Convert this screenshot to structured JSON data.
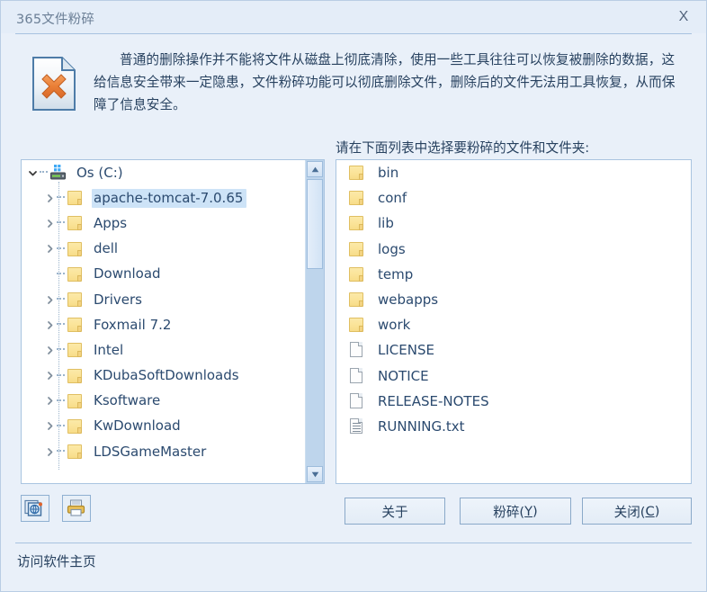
{
  "window": {
    "title": "365文件粉碎",
    "close_label": "X"
  },
  "header": {
    "icon": "shredded-file-icon",
    "description": "普通的删除操作并不能将文件从磁盘上彻底清除，使用一些工具往往可以恢复被删除的数据，这给信息安全带来一定隐患，文件粉碎功能可以彻底删除文件，删除后的文件无法用工具恢复，从而保障了信息安全。"
  },
  "list_label": "请在下面列表中选择要粉碎的文件和文件夹:",
  "tree": {
    "items": [
      {
        "label": "Os (C:)",
        "icon": "drive-icon",
        "expander": "chevron-down",
        "depth": 0,
        "selected": false
      },
      {
        "label": "apache-tomcat-7.0.65",
        "icon": "folder-icon",
        "expander": "chevron-right",
        "depth": 1,
        "selected": true
      },
      {
        "label": "Apps",
        "icon": "folder-icon",
        "expander": "chevron-right",
        "depth": 1,
        "selected": false
      },
      {
        "label": "dell",
        "icon": "folder-icon",
        "expander": "chevron-right",
        "depth": 1,
        "selected": false
      },
      {
        "label": "Download",
        "icon": "folder-icon",
        "expander": "none",
        "depth": 1,
        "selected": false
      },
      {
        "label": "Drivers",
        "icon": "folder-icon",
        "expander": "chevron-right",
        "depth": 1,
        "selected": false
      },
      {
        "label": "Foxmail 7.2",
        "icon": "folder-icon",
        "expander": "chevron-right",
        "depth": 1,
        "selected": false
      },
      {
        "label": "Intel",
        "icon": "folder-icon",
        "expander": "chevron-right",
        "depth": 1,
        "selected": false
      },
      {
        "label": "KDubaSoftDownloads",
        "icon": "folder-icon",
        "expander": "chevron-right",
        "depth": 1,
        "selected": false
      },
      {
        "label": "Ksoftware",
        "icon": "folder-icon",
        "expander": "chevron-right",
        "depth": 1,
        "selected": false
      },
      {
        "label": "KwDownload",
        "icon": "folder-icon",
        "expander": "chevron-right",
        "depth": 1,
        "selected": false
      },
      {
        "label": "LDSGameMaster",
        "icon": "folder-icon",
        "expander": "chevron-right",
        "depth": 1,
        "selected": false
      }
    ],
    "scrollbar": {
      "up_icon": "triangle-up-icon",
      "down_icon": "triangle-down-icon"
    }
  },
  "file_list": {
    "items": [
      {
        "label": "bin",
        "icon": "folder-icon"
      },
      {
        "label": "conf",
        "icon": "folder-icon"
      },
      {
        "label": "lib",
        "icon": "folder-icon"
      },
      {
        "label": "logs",
        "icon": "folder-icon"
      },
      {
        "label": "temp",
        "icon": "folder-icon"
      },
      {
        "label": "webapps",
        "icon": "folder-icon"
      },
      {
        "label": "work",
        "icon": "folder-icon"
      },
      {
        "label": "LICENSE",
        "icon": "file-icon"
      },
      {
        "label": "NOTICE",
        "icon": "file-icon"
      },
      {
        "label": "RELEASE-NOTES",
        "icon": "file-icon"
      },
      {
        "label": "RUNNING.txt",
        "icon": "text-file-icon"
      }
    ]
  },
  "toolbar": {
    "buttons": [
      {
        "name": "homepage-link-icon"
      },
      {
        "name": "printer-icon"
      }
    ]
  },
  "actions": {
    "about": "关于",
    "shred_prefix": "粉碎(",
    "shred_key": "Y",
    "shred_suffix": ")",
    "close_prefix": "关闭(",
    "close_key": "C",
    "close_suffix": ")"
  },
  "status": {
    "text": "访问软件主页"
  },
  "colors": {
    "dialog_bg": "#e9f0f9",
    "title_bg": "#e4edf8",
    "text": "#27415f",
    "selection": "#cde3f7",
    "border": "#a9c4e0",
    "folder": "#fbe49a",
    "accent_x": "#e8803a"
  }
}
